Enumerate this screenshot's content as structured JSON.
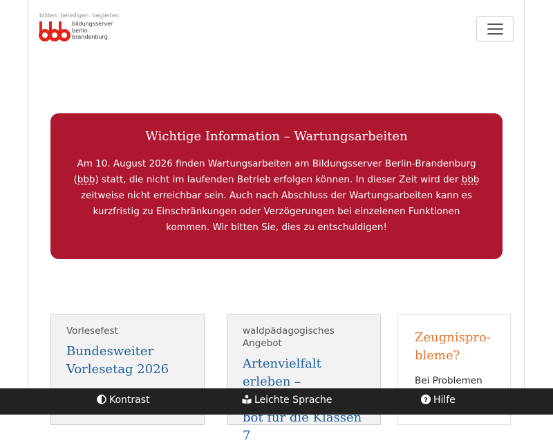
{
  "header": {
    "logo": {
      "tagline": "bilden. beteiligen. begleiten.",
      "lines": [
        "bildungsserver",
        "berlin",
        "brandenburg"
      ]
    },
    "menu_button": {
      "icon": "hamburger-icon"
    }
  },
  "notice": {
    "title": "Wichtige Information – Wartungsarbeiten",
    "text_1": "Am 10. August 2026 finden Wartungsarbeiten am Bildungsserver Berlin-Brandenburg (",
    "abbr_1": "bbb",
    "text_2": ") statt, die nicht im laufenden Betrieb erfolgen können. In dieser Zeit wird der ",
    "abbr_2": "bbb",
    "text_3": " zeitweise nicht erreichbar sein. Auch nach Abschluss der Wartungsarbeiten kann es kurzfristig zu Einschränkun­gen oder Verzögerungen bei einzelenen Funktionen kommen. Wir bitten Sie, dies zu entschuldigen!",
    "background": "#ad1730"
  },
  "cards": [
    {
      "kicker": "Vorlesefest",
      "title": "Bundesweiter Vorle­setag 2026"
    },
    {
      "kicker": "waldpädagogisches Angebot",
      "title": "Artenvielfalt erleben – kostenloses Ange­bot für die Klassen 7"
    },
    {
      "title": "Zeugnispro­bleme?",
      "text": "Bei Problemen"
    }
  ],
  "bottom_bar": {
    "items": [
      {
        "label": "Kontrast",
        "icon": "contrast-icon"
      },
      {
        "label": "Leichte Sprache",
        "icon": "reading-icon"
      },
      {
        "label": "Hilfe",
        "icon": "help-icon"
      }
    ]
  },
  "colors": {
    "link": "#1f5f9e",
    "accent": "#e0752b",
    "brand_red": "#e2261b",
    "bottom_bar": "#222222"
  }
}
